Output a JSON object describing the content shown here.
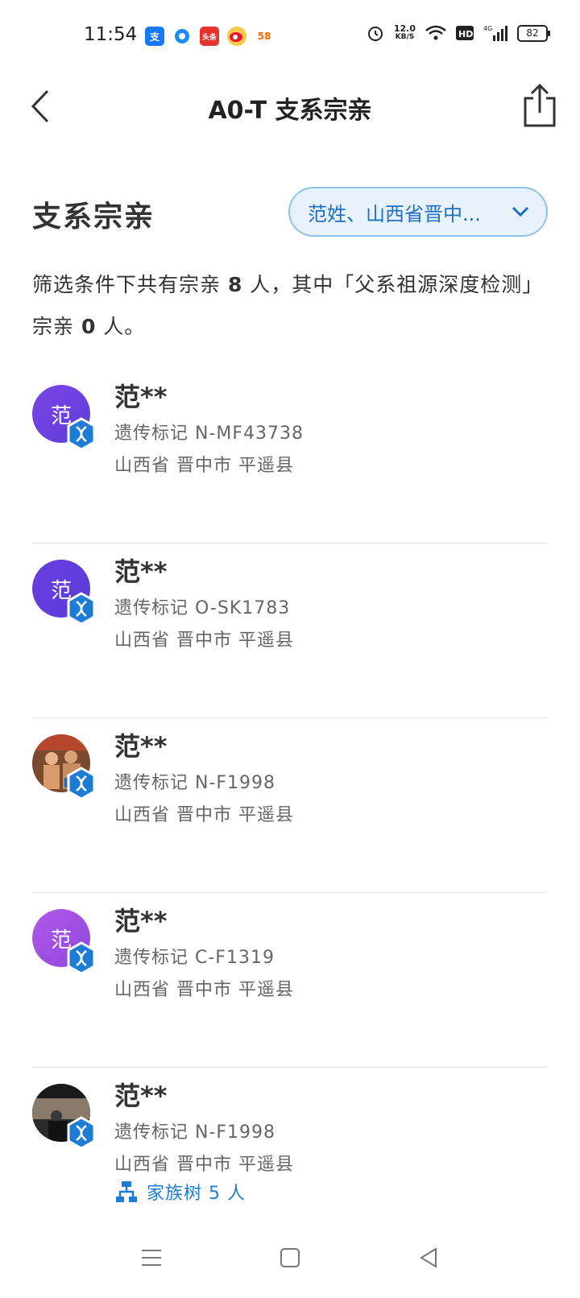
{
  "status_bar": {
    "time": "11:54",
    "speed_value": "12.0",
    "speed_unit": "KB/S",
    "battery": "82",
    "network": "4G",
    "app_icons": [
      "alipay-icon",
      "app-circle-icon",
      "toutiao-icon",
      "weibo-icon",
      "58-icon"
    ]
  },
  "nav": {
    "title": "A0-T 支系宗亲"
  },
  "section": {
    "title": "支系宗亲",
    "filter_label": "范姓、山西省晋中..."
  },
  "summary": {
    "prefix": "筛选条件下共有宗亲 ",
    "total": "8",
    "middle": " 人，其中「父系祖源深度检测」宗亲 ",
    "deep_count": "0",
    "suffix": " 人。"
  },
  "relatives": [
    {
      "name": "范**",
      "avatar_text": "范",
      "avatar_style": "purple1",
      "marker": "遗传标记 N-MF43738",
      "location": "山西省 晋中市 平遥县"
    },
    {
      "name": "范**",
      "avatar_text": "范",
      "avatar_style": "purple2",
      "marker": "遗传标记 O-SK1783",
      "location": "山西省 晋中市 平遥县"
    },
    {
      "name": "范**",
      "avatar_text": "",
      "avatar_style": "photo1",
      "marker": "遗传标记 N-F1998",
      "location": "山西省 晋中市 平遥县"
    },
    {
      "name": "范**",
      "avatar_text": "范",
      "avatar_style": "purple3",
      "marker": "遗传标记 C-F1319",
      "location": "山西省 晋中市 平遥县"
    },
    {
      "name": "范**",
      "avatar_text": "",
      "avatar_style": "photo2",
      "marker": "遗传标记 N-F1998",
      "location": "山西省 晋中市 平遥县",
      "family_tree": "家族树 5 人"
    }
  ],
  "colors": {
    "accent": "#1e7cd6",
    "filter_bg": "#e7f2fc",
    "badge": "#1e7cd6"
  }
}
